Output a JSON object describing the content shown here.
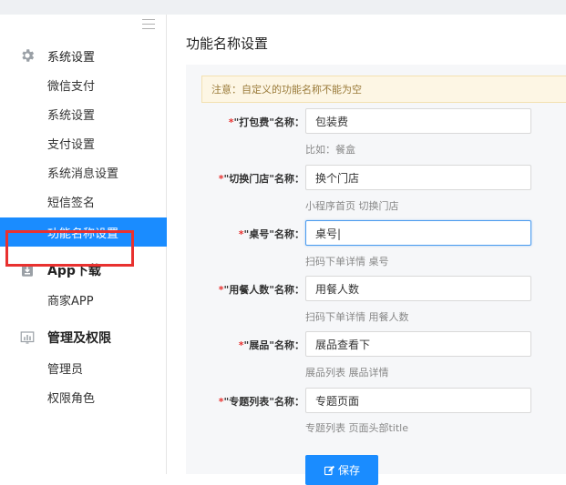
{
  "sidebar": {
    "groups": [
      {
        "title": "系统设置",
        "icon": "gear-icon",
        "items": [
          {
            "label": "微信支付"
          },
          {
            "label": "系统设置"
          },
          {
            "label": "支付设置"
          },
          {
            "label": "系统消息设置"
          },
          {
            "label": "短信签名"
          },
          {
            "label": "功能名称设置"
          }
        ]
      },
      {
        "title": "App下载",
        "icon": "download-icon",
        "items": [
          {
            "label": "商家APP"
          }
        ]
      },
      {
        "title": "管理及权限",
        "icon": "chart-icon",
        "items": [
          {
            "label": "管理员"
          },
          {
            "label": "权限角色"
          }
        ]
      }
    ],
    "active_item": "功能名称设置"
  },
  "main": {
    "title": "功能名称设置",
    "notice": "注意：自定义的功能名称不能为空",
    "fields": [
      {
        "required_mark": "*",
        "label": "\"打包费\"名称：",
        "value": "包装费",
        "hint": "比如：餐盒"
      },
      {
        "required_mark": "*",
        "label": "\"切换门店\"名称：",
        "value": "换个门店",
        "hint": "小程序首页 切换门店"
      },
      {
        "required_mark": "*",
        "label": "\"桌号\"名称：",
        "value": "桌号|",
        "hint": "扫码下单详情 桌号"
      },
      {
        "required_mark": "*",
        "label": "\"用餐人数\"名称：",
        "value": "用餐人数",
        "hint": "扫码下单详情 用餐人数"
      },
      {
        "required_mark": "*",
        "label": "\"展品\"名称：",
        "value": "展品查看下",
        "hint": "展品列表 展品详情"
      },
      {
        "required_mark": "*",
        "label": "\"专题列表\"名称：",
        "value": "专题页面",
        "hint": "专题列表 页面头部title"
      }
    ],
    "save_label": "保存"
  },
  "colors": {
    "accent": "#1a8cff",
    "highlight_outline": "#e8312f",
    "notice_bg": "#fdf6e4"
  }
}
